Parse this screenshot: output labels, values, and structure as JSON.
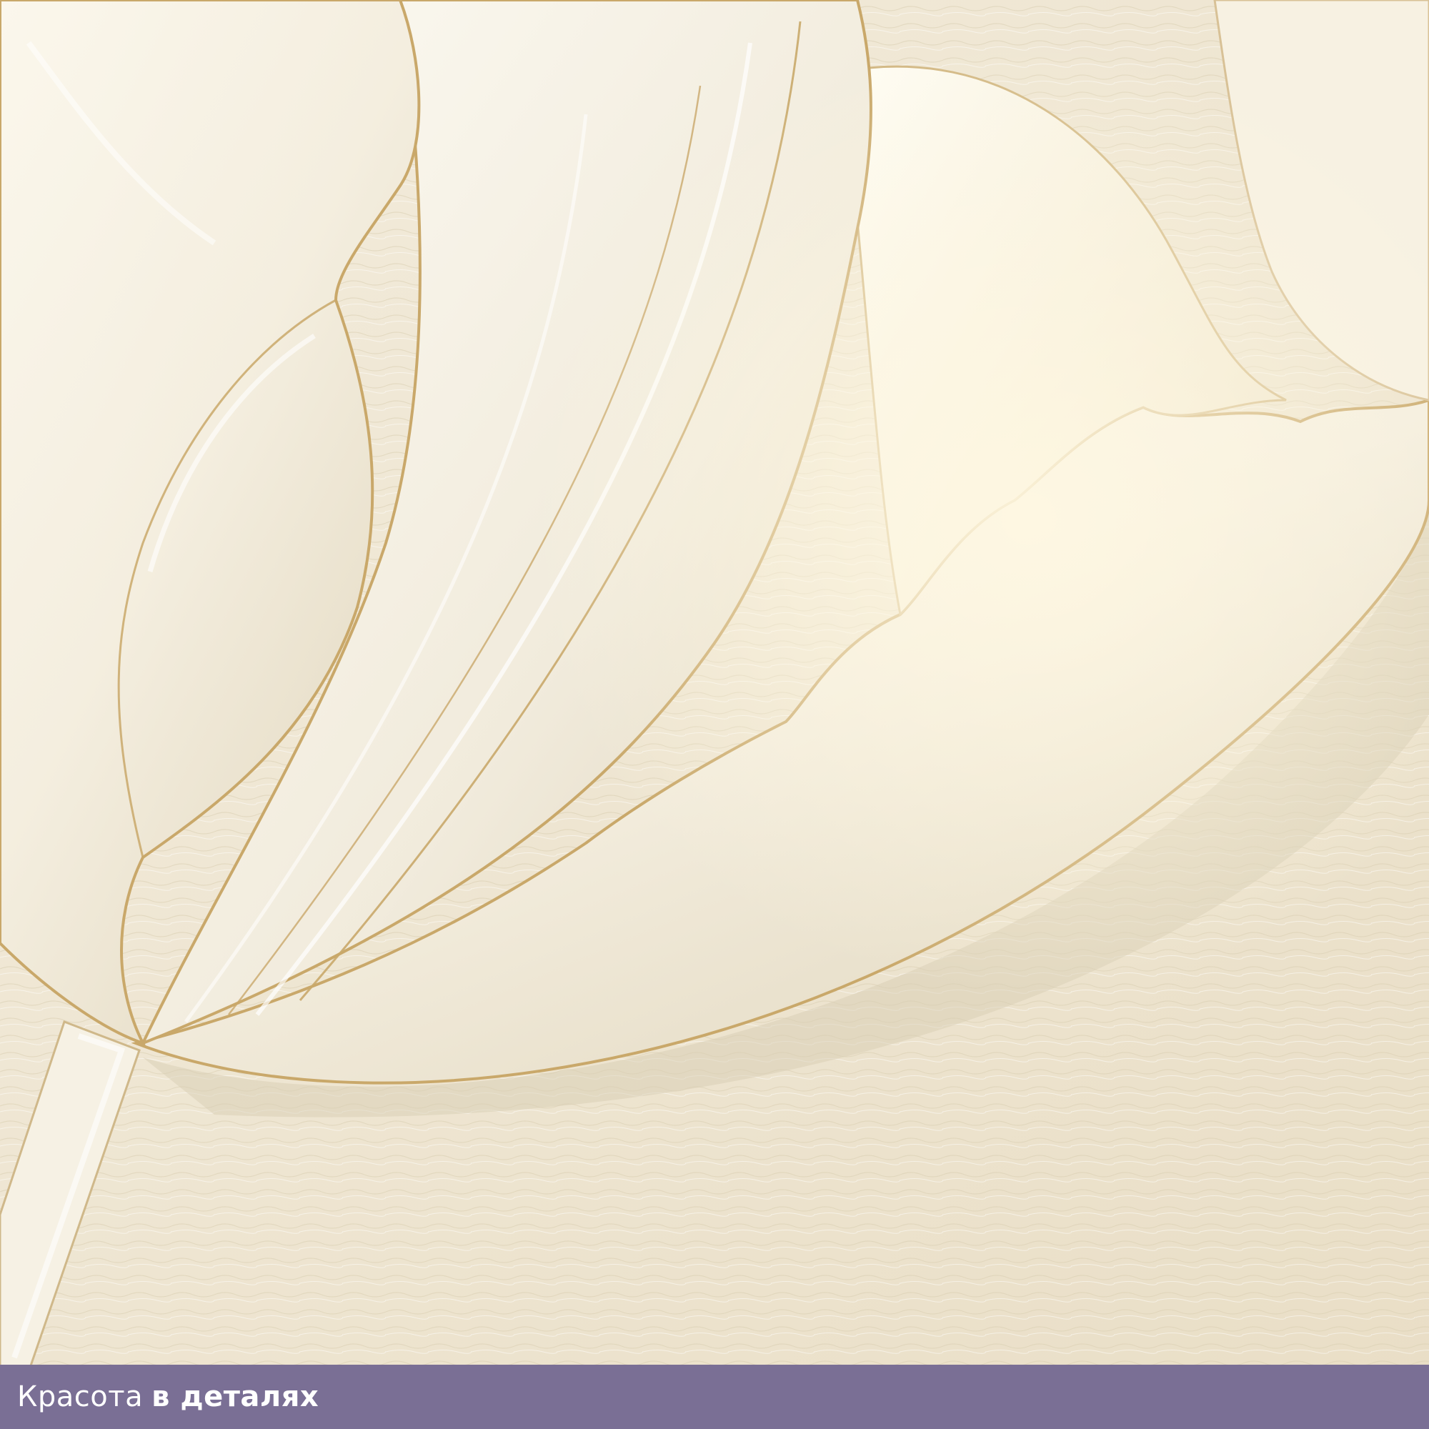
{
  "caption": {
    "light_text": "Красота ",
    "bold_text": "в деталях"
  },
  "colors": {
    "background_wall": "#efe6d2",
    "petal_light": "#fbf8ef",
    "petal_shadow": "#e3dac4",
    "gold_outline": "#c9a86a",
    "caption_bar": "#7a6f95",
    "caption_text": "#ffffff"
  },
  "image": {
    "subject": "white-tulip-relief"
  }
}
